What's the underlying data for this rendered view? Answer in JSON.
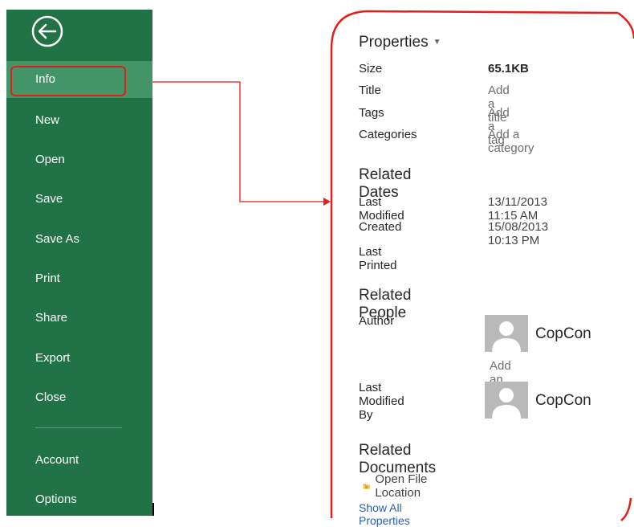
{
  "sidebar": {
    "back_icon": "back-arrow-icon",
    "items": [
      {
        "label": "Info"
      },
      {
        "label": "New"
      },
      {
        "label": "Open"
      },
      {
        "label": "Save"
      },
      {
        "label": "Save As"
      },
      {
        "label": "Print"
      },
      {
        "label": "Share"
      },
      {
        "label": "Export"
      },
      {
        "label": "Close"
      },
      {
        "label": "Account"
      },
      {
        "label": "Options"
      }
    ],
    "active": "Info",
    "color": "#217346",
    "active_color": "#439467"
  },
  "annotation_color": "#e0201a",
  "properties": {
    "title": "Properties",
    "size": {
      "label": "Size",
      "value": "65.1KB"
    },
    "title_field": {
      "label": "Title",
      "value": "Add a title"
    },
    "tags": {
      "label": "Tags",
      "value": "Add a tag"
    },
    "categories": {
      "label": "Categories",
      "value": "Add a category"
    }
  },
  "related_dates": {
    "title": "Related Dates",
    "last_modified": {
      "label": "Last Modified",
      "value": "13/11/2013 11:15 AM"
    },
    "created": {
      "label": "Created",
      "value": "15/08/2013 10:13 PM"
    },
    "last_printed": {
      "label": "Last Printed",
      "value": ""
    }
  },
  "related_people": {
    "title": "Related People",
    "author": {
      "label": "Author",
      "name": "CopCon",
      "add": "Add an author"
    },
    "last_modified_by": {
      "label": "Last Modified By",
      "name": "CopCon"
    }
  },
  "related_documents": {
    "title": "Related Documents",
    "open_location": "Open File Location"
  },
  "show_all": "Show All Properties"
}
